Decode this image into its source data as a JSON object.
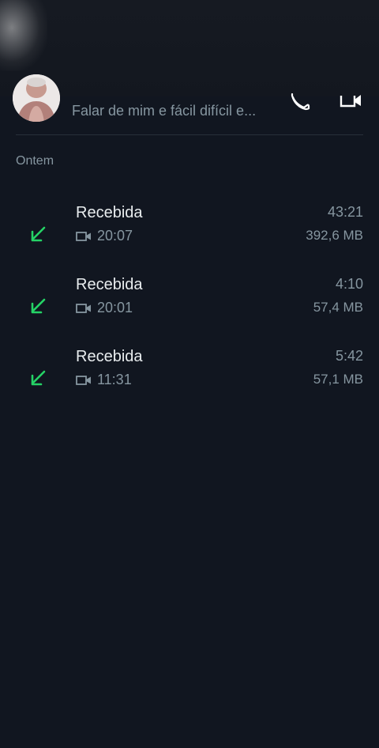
{
  "header": {
    "status": "Falar de mim e fácil difícil e..."
  },
  "section": {
    "label": "Ontem"
  },
  "calls": [
    {
      "type": "Recebida",
      "time": "20:07",
      "duration": "43:21",
      "size": "392,6 MB"
    },
    {
      "type": "Recebida",
      "time": "20:01",
      "duration": "4:10",
      "size": "57,4 MB"
    },
    {
      "type": "Recebida",
      "time": "11:31",
      "duration": "5:42",
      "size": "57,1 MB"
    }
  ],
  "colors": {
    "background": "#111620",
    "incoming_arrow": "#25d366",
    "secondary_text": "#8696a0",
    "primary_text": "#e9edef"
  },
  "icons": {
    "voice_call": "phone-icon",
    "video_call": "video-call-icon",
    "incoming": "incoming-arrow-icon",
    "media": "video-camera-icon"
  }
}
